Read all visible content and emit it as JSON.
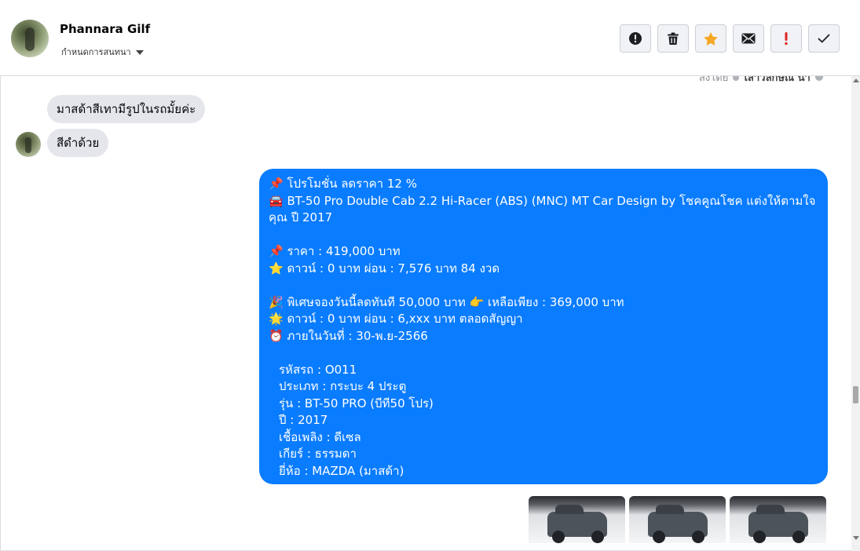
{
  "contact": {
    "name": "Phannara Gilf",
    "subtitle": "กำหนดการสนทนา"
  },
  "toolbar": {
    "buttons": [
      {
        "icon": "alert-circle-icon"
      },
      {
        "icon": "trash-icon"
      },
      {
        "icon": "star-icon",
        "color": "#f5a623"
      },
      {
        "icon": "envelope-icon"
      },
      {
        "icon": "exclamation-icon",
        "color": "#e02424"
      },
      {
        "icon": "check-icon"
      }
    ]
  },
  "chat": {
    "truncated_top": {
      "prefix": "ส่งโดย",
      "bold": "เสาวลักษณ์ น้ำ"
    },
    "incoming": [
      {
        "text": "มาสด้าสีเทามีรูปในรถมั้ยค่ะ"
      },
      {
        "text": "สีดำด้วย"
      }
    ],
    "outgoing": {
      "bubble_color": "#0a7cff",
      "lines": [
        "📌 โปรโมชั่น ลดราคา 12 %",
        "🚘 BT-50 Pro Double Cab 2.2 Hi-Racer (ABS) (MNC) MT Car Design by โชคคูณโชค แต่งให้ตามใจคุณ ปี 2017",
        "",
        "📌 ราคา : 419,000 บาท",
        "⭐ ดาวน์ : 0 บาท ผ่อน : 7,576 บาท 84 งวด",
        "",
        "🎉 พิเศษจองวันนี้ลดทันที 50,000 บาท 👉 เหลือเพียง : 369,000 บาท",
        "🌟 ดาวน์ : 0 บาท ผ่อน : 6,xxx บาท ตลอดสัญญา",
        "⏰ ภายในวันที่ : 30-พ.ย-2566",
        "",
        "รหัสรถ : O011",
        "ประเภท : กระบะ 4 ประตู",
        "รุ่น : BT-50 PRO (บีที50 โปร)",
        "ปี : 2017",
        "เชื้อเพลิง : ดีเซล",
        "เกียร์ : ธรรมดา",
        "ยี่ห้อ : MAZDA (มาสด้า)"
      ]
    },
    "attachments": {
      "count": 3,
      "kind": "car-photo"
    }
  }
}
